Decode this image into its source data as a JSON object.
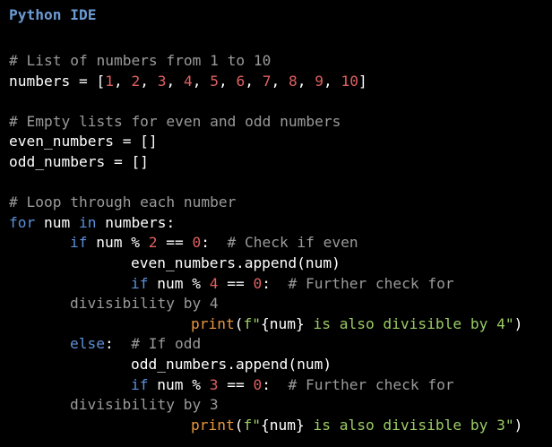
{
  "app": {
    "title": "Python IDE"
  },
  "colors": {
    "background": "#000000",
    "title": "#6b9bd2",
    "comment": "#9a9a9a",
    "keyword": "#5b8fd9",
    "number": "#e06060",
    "builtin": "#e8973e",
    "string": "#9ccc65",
    "plain": "#ffffff"
  },
  "editor": {
    "lines": [
      {
        "indent": 0,
        "tokens": [
          {
            "t": "comment",
            "v": "# List of numbers from 1 to 10"
          }
        ]
      },
      {
        "indent": 0,
        "tokens": [
          {
            "t": "plain",
            "v": "numbers = ["
          },
          {
            "t": "number",
            "v": "1"
          },
          {
            "t": "plain",
            "v": ", "
          },
          {
            "t": "number",
            "v": "2"
          },
          {
            "t": "plain",
            "v": ", "
          },
          {
            "t": "number",
            "v": "3"
          },
          {
            "t": "plain",
            "v": ", "
          },
          {
            "t": "number",
            "v": "4"
          },
          {
            "t": "plain",
            "v": ", "
          },
          {
            "t": "number",
            "v": "5"
          },
          {
            "t": "plain",
            "v": ", "
          },
          {
            "t": "number",
            "v": "6"
          },
          {
            "t": "plain",
            "v": ", "
          },
          {
            "t": "number",
            "v": "7"
          },
          {
            "t": "plain",
            "v": ", "
          },
          {
            "t": "number",
            "v": "8"
          },
          {
            "t": "plain",
            "v": ", "
          },
          {
            "t": "number",
            "v": "9"
          },
          {
            "t": "plain",
            "v": ", "
          },
          {
            "t": "number",
            "v": "10"
          },
          {
            "t": "plain",
            "v": "]"
          }
        ]
      },
      {
        "indent": 0,
        "tokens": []
      },
      {
        "indent": 0,
        "tokens": [
          {
            "t": "comment",
            "v": "# Empty lists for even and odd numbers"
          }
        ]
      },
      {
        "indent": 0,
        "tokens": [
          {
            "t": "plain",
            "v": "even_numbers = []"
          }
        ]
      },
      {
        "indent": 0,
        "tokens": [
          {
            "t": "plain",
            "v": "odd_numbers = []"
          }
        ]
      },
      {
        "indent": 0,
        "tokens": []
      },
      {
        "indent": 0,
        "tokens": [
          {
            "t": "comment",
            "v": "# Loop through each number"
          }
        ]
      },
      {
        "indent": 0,
        "tokens": [
          {
            "t": "keyword",
            "v": "for"
          },
          {
            "t": "plain",
            "v": " num "
          },
          {
            "t": "keyword",
            "v": "in"
          },
          {
            "t": "plain",
            "v": " numbers:"
          }
        ]
      },
      {
        "indent": 1,
        "tokens": [
          {
            "t": "keyword",
            "v": "if"
          },
          {
            "t": "plain",
            "v": " num % "
          },
          {
            "t": "number",
            "v": "2"
          },
          {
            "t": "plain",
            "v": " == "
          },
          {
            "t": "number",
            "v": "0"
          },
          {
            "t": "plain",
            "v": ":  "
          },
          {
            "t": "comment",
            "v": "# Check if even"
          }
        ]
      },
      {
        "indent": 2,
        "tokens": [
          {
            "t": "plain",
            "v": "even_numbers.append(num)"
          }
        ]
      },
      {
        "indent": 2,
        "tokens": [
          {
            "t": "keyword",
            "v": "if"
          },
          {
            "t": "plain",
            "v": " num % "
          },
          {
            "t": "number",
            "v": "4"
          },
          {
            "t": "plain",
            "v": " == "
          },
          {
            "t": "number",
            "v": "0"
          },
          {
            "t": "plain",
            "v": ":  "
          },
          {
            "t": "comment",
            "v": "# Further check for"
          }
        ]
      },
      {
        "indent": 1,
        "tokens": [
          {
            "t": "comment",
            "v": "divisibility by 4"
          }
        ]
      },
      {
        "indent": 3,
        "tokens": [
          {
            "t": "builtin",
            "v": "print"
          },
          {
            "t": "plain",
            "v": "("
          },
          {
            "t": "string",
            "v": "f\""
          },
          {
            "t": "plain",
            "v": "{num}"
          },
          {
            "t": "string",
            "v": " is also divisible by 4\""
          },
          {
            "t": "plain",
            "v": ")"
          }
        ]
      },
      {
        "indent": 1,
        "tokens": [
          {
            "t": "keyword",
            "v": "else"
          },
          {
            "t": "plain",
            "v": ":  "
          },
          {
            "t": "comment",
            "v": "# If odd"
          }
        ]
      },
      {
        "indent": 2,
        "tokens": [
          {
            "t": "plain",
            "v": "odd_numbers.append(num)"
          }
        ]
      },
      {
        "indent": 2,
        "tokens": [
          {
            "t": "keyword",
            "v": "if"
          },
          {
            "t": "plain",
            "v": " num % "
          },
          {
            "t": "number",
            "v": "3"
          },
          {
            "t": "plain",
            "v": " == "
          },
          {
            "t": "number",
            "v": "0"
          },
          {
            "t": "plain",
            "v": ":  "
          },
          {
            "t": "comment",
            "v": "# Further check for"
          }
        ]
      },
      {
        "indent": 1,
        "tokens": [
          {
            "t": "comment",
            "v": "divisibility by 3"
          }
        ]
      },
      {
        "indent": 3,
        "tokens": [
          {
            "t": "builtin",
            "v": "print"
          },
          {
            "t": "plain",
            "v": "("
          },
          {
            "t": "string",
            "v": "f\""
          },
          {
            "t": "plain",
            "v": "{num}"
          },
          {
            "t": "string",
            "v": " is also divisible by 3\""
          },
          {
            "t": "plain",
            "v": ")"
          }
        ]
      }
    ]
  }
}
